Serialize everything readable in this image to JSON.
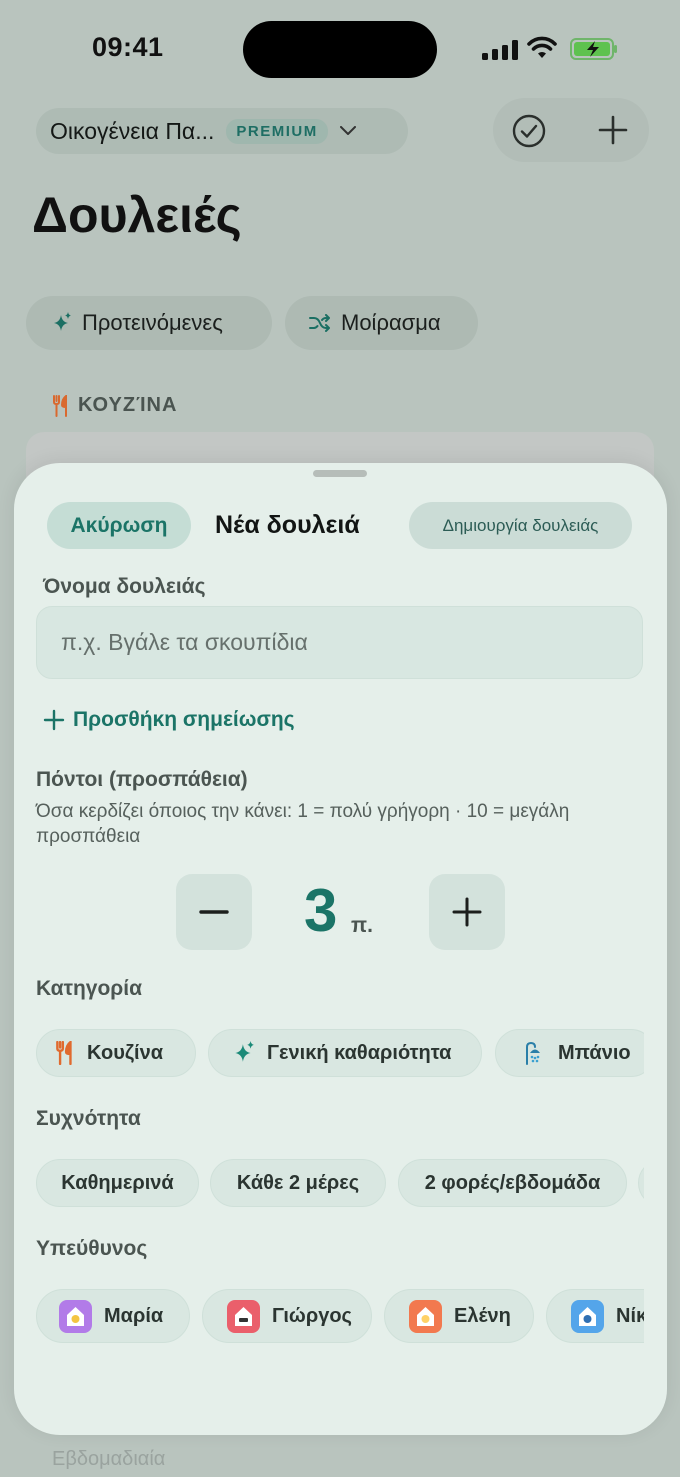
{
  "status": {
    "time": "09:41"
  },
  "header": {
    "family_name": "Οικογένεια Πα...",
    "badge": "PREMIUM",
    "title": "Δουλειές"
  },
  "filters": [
    {
      "label": "Προτεινόμενες",
      "icon": "sparkles-icon"
    },
    {
      "label": "Μοίρασμα",
      "icon": "shuffle-icon"
    }
  ],
  "section": {
    "label": "ΚΟΥΖΊΝΑ",
    "icon": "fork-knife-icon"
  },
  "background_bottom": "Εβδομαδιαία",
  "sheet": {
    "cancel": "Ακύρωση",
    "title": "Νέα δουλειά",
    "create": "Δημιουργία δουλειάς",
    "name_label": "Όνομα δουλειάς",
    "name_placeholder": "π.χ. Βγάλε τα σκουπίδια",
    "add_note": "Προσθήκη σημείωσης",
    "points_label": "Πόντοι (προσπάθεια)",
    "points_help": "Όσα κερδίζει όποιος την κάνει: 1 = πολύ γρήγορη · 10 = μεγάλη προσπάθεια",
    "points_value": "3",
    "points_unit": "π.",
    "category_label": "Κατηγορία",
    "categories": [
      {
        "label": "Κουζίνα",
        "icon": "fork-knife-icon"
      },
      {
        "label": "Γενική καθαριότητα",
        "icon": "sparkles-icon"
      },
      {
        "label": "Μπάνιο",
        "icon": "shower-icon"
      }
    ],
    "frequency_label": "Συχνότητα",
    "frequencies": [
      "Καθημερινά",
      "Κάθε 2 μέρες",
      "2 φορές/εβδομάδα"
    ],
    "assignee_label": "Υπεύθυνος",
    "assignees": [
      {
        "name": "Μαρία",
        "color": "#b27be8"
      },
      {
        "name": "Γιώργος",
        "color": "#ea5f6b"
      },
      {
        "name": "Ελένη",
        "color": "#f2794f"
      },
      {
        "name": "Νίκ",
        "color": "#54a5ea"
      }
    ]
  },
  "colors": {
    "accent": "#1b7467",
    "sheet": "#e5efea"
  }
}
